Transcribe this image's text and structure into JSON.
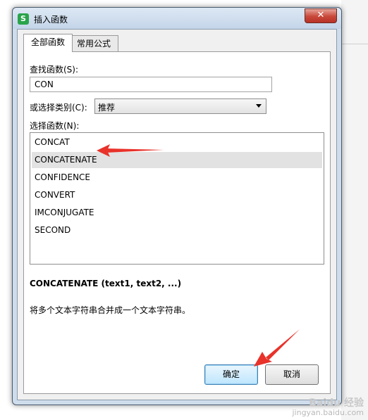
{
  "window": {
    "title": "插入函数",
    "app_icon_letter": "S",
    "close_glyph": "✕"
  },
  "tabs": [
    {
      "label": "全部函数",
      "active": true
    },
    {
      "label": "常用公式",
      "active": false
    }
  ],
  "search": {
    "label": "查找函数(S):",
    "value": "CON"
  },
  "category": {
    "label": "或选择类别(C):",
    "selected": "推荐"
  },
  "function_list": {
    "label": "选择函数(N):",
    "items": [
      "CONCAT",
      "CONCATENATE",
      "CONFIDENCE",
      "CONVERT",
      "IMCONJUGATE",
      "SECOND"
    ],
    "selected_index": 1
  },
  "description": {
    "signature": "CONCATENATE (text1, text2, ...)",
    "text": "将多个文本字符串合并成一个文本字符串。"
  },
  "buttons": {
    "ok": "确定",
    "cancel": "取消"
  },
  "colors": {
    "annotation_arrow": "#e8322a",
    "selected_row": "#e2e2e2"
  },
  "watermark": {
    "brand": "Baidu 经验",
    "url": "jingyan.baidu.com"
  }
}
